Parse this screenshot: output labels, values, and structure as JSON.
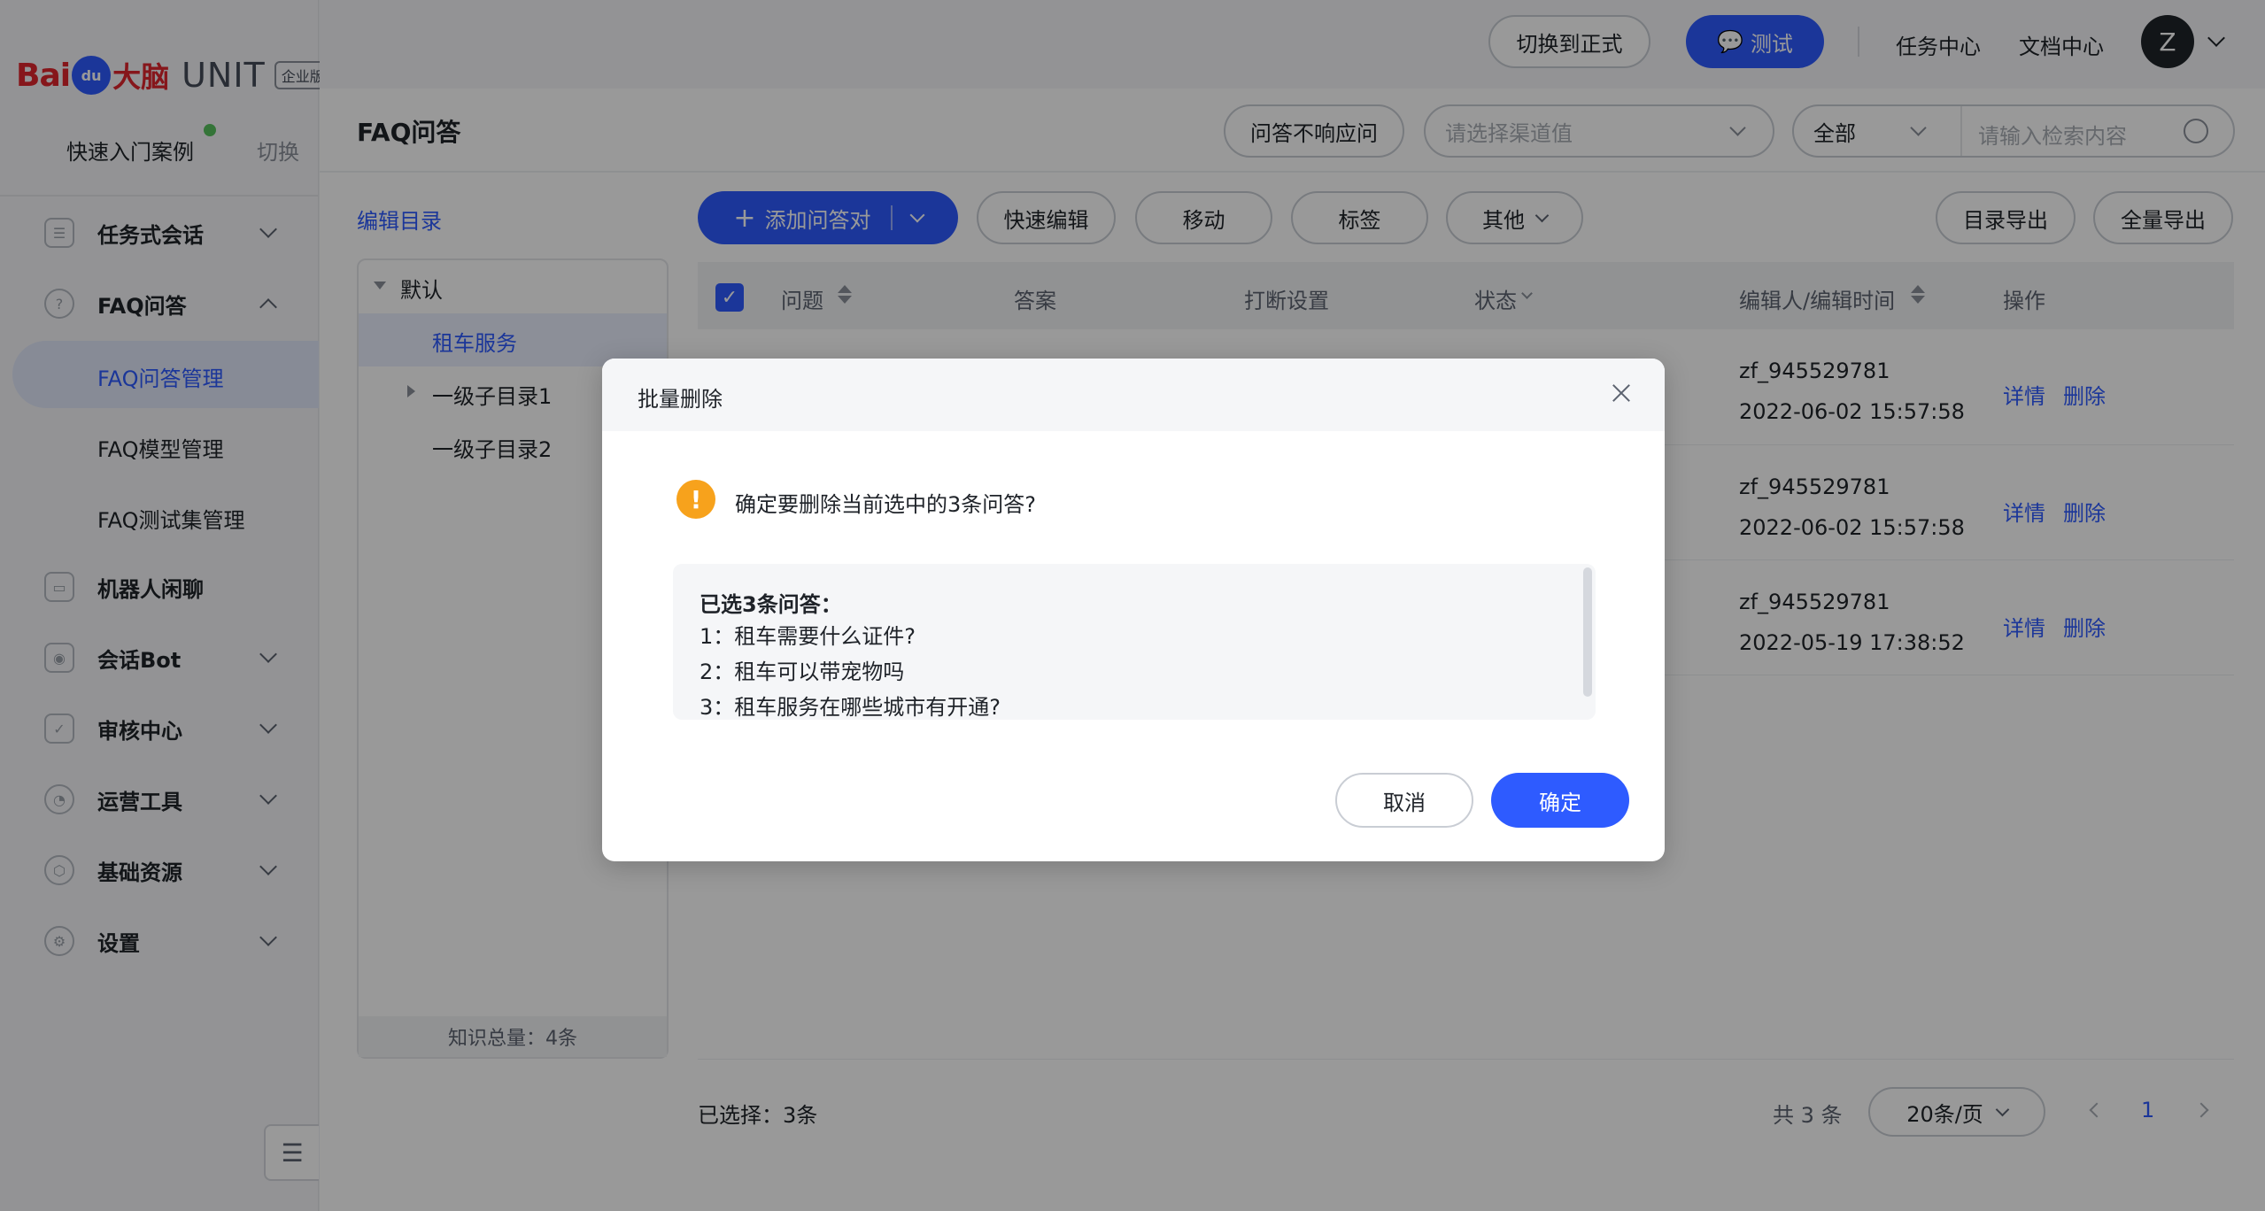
{
  "brand": {
    "logo_bai": "Bai",
    "logo_du": "du",
    "logo_brain": "大脑",
    "logo_unit": "UNIT",
    "logo_tag": "企业版"
  },
  "sidebar": {
    "quick_start": "快速入门案例",
    "switch_label": "切换",
    "items": [
      {
        "label": "任务式会话",
        "icon": "task-dialog-icon"
      },
      {
        "label": "FAQ问答",
        "icon": "faq-icon"
      },
      {
        "label": "机器人闲聊",
        "icon": "chat-icon"
      },
      {
        "label": "会话Bot",
        "icon": "bot-icon"
      },
      {
        "label": "审核中心",
        "icon": "shield-icon"
      },
      {
        "label": "运营工具",
        "icon": "ops-icon"
      },
      {
        "label": "基础资源",
        "icon": "resource-icon"
      },
      {
        "label": "设置",
        "icon": "gear-icon"
      }
    ],
    "faq_sub": [
      "FAQ问答管理",
      "FAQ模型管理",
      "FAQ测试集管理"
    ]
  },
  "topbar": {
    "switch_formal": "切换到正式",
    "test": "测试",
    "task_center": "任务中心",
    "doc_center": "文档中心",
    "avatar_initial": "Z"
  },
  "page": {
    "title": "FAQ问答",
    "no_response_btn": "问答不响应问",
    "channel_placeholder": "请选择渠道值",
    "scope_select": "全部",
    "search_placeholder": "请输入检索内容"
  },
  "directory": {
    "edit_label": "编辑目录",
    "root": "默认",
    "selected": "租车服务",
    "children": [
      "一级子目录1",
      "一级子目录2"
    ],
    "total": "知识总量：4条"
  },
  "toolbar": {
    "add_pair": "添加问答对",
    "quick_edit": "快速编辑",
    "move": "移动",
    "tag": "标签",
    "other": "其他",
    "export_dir": "目录导出",
    "export_all": "全量导出"
  },
  "table": {
    "headers": [
      "问题",
      "答案",
      "打断设置",
      "状态",
      "编辑人/编辑时间",
      "操作"
    ],
    "rows": [
      {
        "editor": "zf_945529781",
        "time": "2022-06-02 15:57:58",
        "detail": "详情",
        "delete": "删除"
      },
      {
        "editor": "zf_945529781",
        "time": "2022-06-02 15:57:58",
        "detail": "详情",
        "delete": "删除"
      },
      {
        "editor": "zf_945529781",
        "time": "2022-05-19 17:38:52",
        "detail": "详情",
        "delete": "删除"
      }
    ]
  },
  "footer": {
    "selected": "已选择：3条",
    "total": "共 3 条",
    "page_size": "20条/页",
    "current_page": "1"
  },
  "dialog": {
    "title": "批量删除",
    "message": "确定要删除当前选中的3条问答?",
    "list_title": "已选3条问答：",
    "items": [
      "1：租车需要什么证件?",
      "2：租车可以带宠物吗",
      "3：租车服务在哪些城市有开通?"
    ],
    "cancel": "取消",
    "confirm": "确定"
  },
  "colors": {
    "accent": "#2e5bff",
    "warning": "#f7a21c",
    "brand_red": "#e0262e"
  }
}
